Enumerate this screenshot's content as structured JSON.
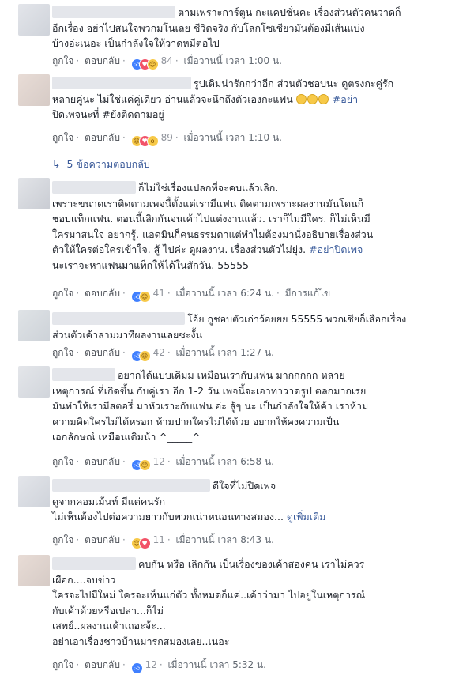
{
  "labels": {
    "like": "ถูกใจ",
    "reply": "ตอบกลับ",
    "sep": "·"
  },
  "reaction_icons": {
    "like": "thumbs-up-icon",
    "love": "heart-icon",
    "haha": "laughing-face-icon",
    "wow": "surprised-face-icon"
  },
  "colors": {
    "link": "#365899",
    "meta": "#90949c",
    "like": "#4080ff",
    "love": "#f25268",
    "haha": "#f7c948"
  },
  "comments": [
    {
      "lines": [
        "ตามเพราะการ์ตูน กะแคปชั่นคะ เรื่องส่วนตัวคนวาดก็",
        "อีกเรื่อง อย่าไปสนใจพวกมโนเลย ชีวิตจริง กับโลกโซเชียวมันต้องมีเส้นแบ่ง",
        "บ้างอ่ะเนอะ เป็นกำลังใจให้วาดหมีต่อไป"
      ],
      "reaction_count": "84",
      "time": "เมื่อวานนี้ เวลา 1:00 น."
    },
    {
      "lines": [
        "รูปเดิมน่ารักกว่าอีก ส่วนตัวชอบนะ ดูตรงกะคู่รัก",
        "หลายคู่นะ ไม่ใช่แค่คู่เดียว อ่านแล้วจะนึกถึงตัวเองกะแฟน",
        "ปิดเพจนะที่ #ยังติดตามอยู่"
      ],
      "hashtag_inline": "#อย่า",
      "reaction_count": "89",
      "time": "เมื่อวานนี้ เวลา 1:10 น.",
      "replies": "5 ข้อความตอบกลับ"
    },
    {
      "lines": [
        "ก็ไม่ใช่เรื่องแปลกที่จะคบแล้วเลิก.",
        "เพราะขนาดเราติดตามเพจนี้ตั้งแต่เรามีแฟน ติดตามเพราะผลงานมันโดนก็",
        "ชอบแท็กแฟน. ตอนนี้เลิกกันจนเค้าไปแต่งงานแล้ว. เราก็ไม่มีใคร. ก็ไม่เห็นมี",
        "ใครมาสนใจ อยากรู้. แอดมินก็คนธรรมดาแต่ทำไมต้องมานั่งอธิบายเรื่องส่วน",
        "ตัวให้ใครต่อใครเข้าใจ. สู้ ไปค่ะ ดูผลงาน. เรื่องส่วนตัวไม่ยุ่ง.",
        "นะเราจะหาแฟนมาแท็กให้ได้ในสักวัน. 55555"
      ],
      "hashtag_inline": "#อย่าปิดเพจ",
      "reaction_count": "41",
      "time": "เมื่อวานนี้ เวลา 6:24 น.",
      "edited": "มีการแก้ไข"
    },
    {
      "lines": [
        "โอ้ย กูชอบตัวเก่าว้อยยย 55555 พวกเชียก็เสือกเรื่อง",
        "ส่วนตัวเค้าลามมาทีผลงานเลยซะงั้น"
      ],
      "reaction_count": "42",
      "time": "เมื่อวานนี้ เวลา 1:27 น."
    },
    {
      "lines": [
        "อยากได้แบบเดิมม เหมือนเรากับแฟน มากกกกก หลาย",
        "เหตุการณ์ ที่เกิดขึ้น กับคู่เรา อีก 1-2 วัน เพจนี้จะเอาทาวาดรูป ตลกมากเรย",
        "มันทำให้เรามีสตอรี่ มาหัวเราะกับแฟน อ่ะ สู้ๆ นะ เป็นกำลังใจให้ค้า เราห้าม",
        "ความคิดใครไม่ได้หรอก ห้ามปากใครไม่ได้ด้วย อยากให้คงความเป็น",
        "เอกลักษณ์ เหมือนเดิมน้า ^_____^"
      ],
      "reaction_count": "12",
      "time": "เมื่อวานนี้ เวลา 6:58 น."
    },
    {
      "lines": [
        "ดีใจที่ไม่ปิดเพจ",
        "ดูจากคอมเม้นท์ มีแต่คนรัก",
        "ไม่เห็นต้องไปต่อความยาวกับพวกเน่าหนอนทางสมอง..."
      ],
      "see_more": "ดูเพิ่มเติม",
      "reaction_count": "11",
      "time": "เมื่อวานนี้ เวลา 8:43 น."
    },
    {
      "lines": [
        "คบกัน หรือ เลิกกัน เป็นเรื่องของเค้าสองคน เราไม่ควร",
        "เผือก....จบข่าว",
        "ใครจะไปมีใหม่ ใครจะเห็นแก่ตัว ทั้งหมดก็แค่..เค้าว่ามา ไปอยู่ในเหตุการณ์",
        "กับเค้าด้วยหรือเปล่า...ก็ไม่",
        "เสพย์..ผลงานเค้าเถอะจ้ะ...",
        "อย่าเอาเรื่องชาวบ้านมารกสมองเลย..เนอะ"
      ],
      "reaction_count": "12",
      "time": "เมื่อวานนี้ เวลา 5:32 น."
    }
  ]
}
